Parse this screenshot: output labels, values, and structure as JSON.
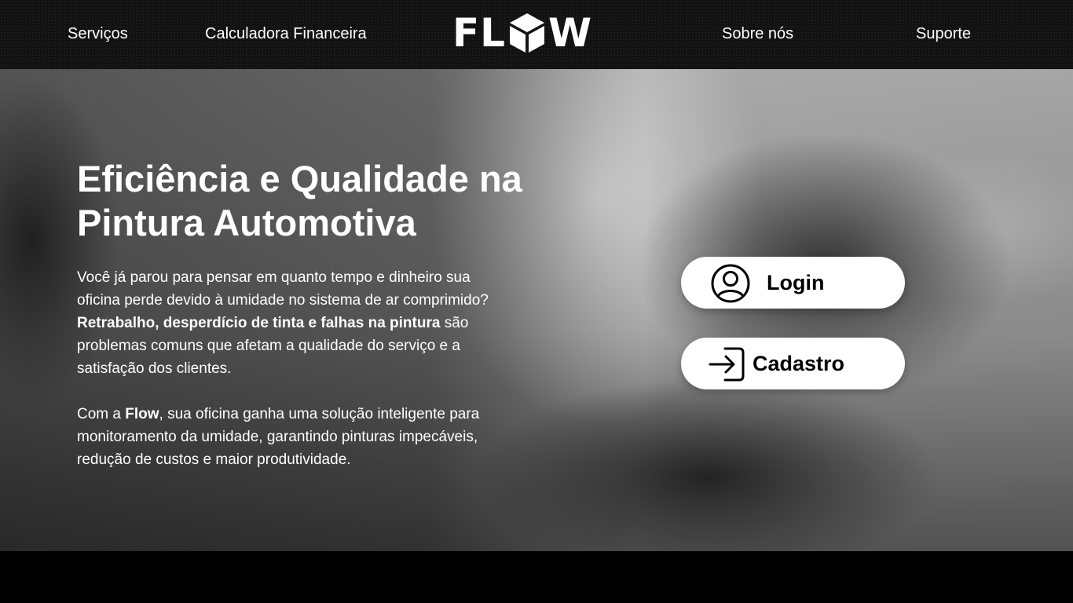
{
  "nav": {
    "links": [
      "Serviços",
      "Calculadora Financeira",
      "Sobre nós",
      "Suporte"
    ],
    "logo": {
      "left_text": "FL",
      "right_text": "W",
      "mark_icon": "cube-icon"
    }
  },
  "hero": {
    "title": "Eficiência e Qualidade na Pintura Automotiva",
    "p1_pre": "Você já parou para pensar em quanto tempo e dinheiro sua oficina perde devido à umidade no sistema de ar comprimido? ",
    "p1_bold": "Retrabalho, desperdício de tinta e falhas na pintura",
    "p1_post": " são problemas comuns que afetam a qualidade do serviço e a satisfação dos clientes.",
    "p2_pre": "Com a ",
    "p2_bold": "Flow",
    "p2_post": ", sua oficina ganha uma solução inteligente para monitoramento da umidade, garantindo pinturas impecáveis, redução de custos e maior produtividade."
  },
  "actions": {
    "login_label": "Login",
    "login_icon": "user-circle-icon",
    "cadastro_label": "Cadastro",
    "cadastro_icon": "sign-in-icon"
  },
  "colors": {
    "navbar": "#111111",
    "button_bg": "#ffffff",
    "text_light": "#ffffff",
    "text_dark": "#000000"
  }
}
